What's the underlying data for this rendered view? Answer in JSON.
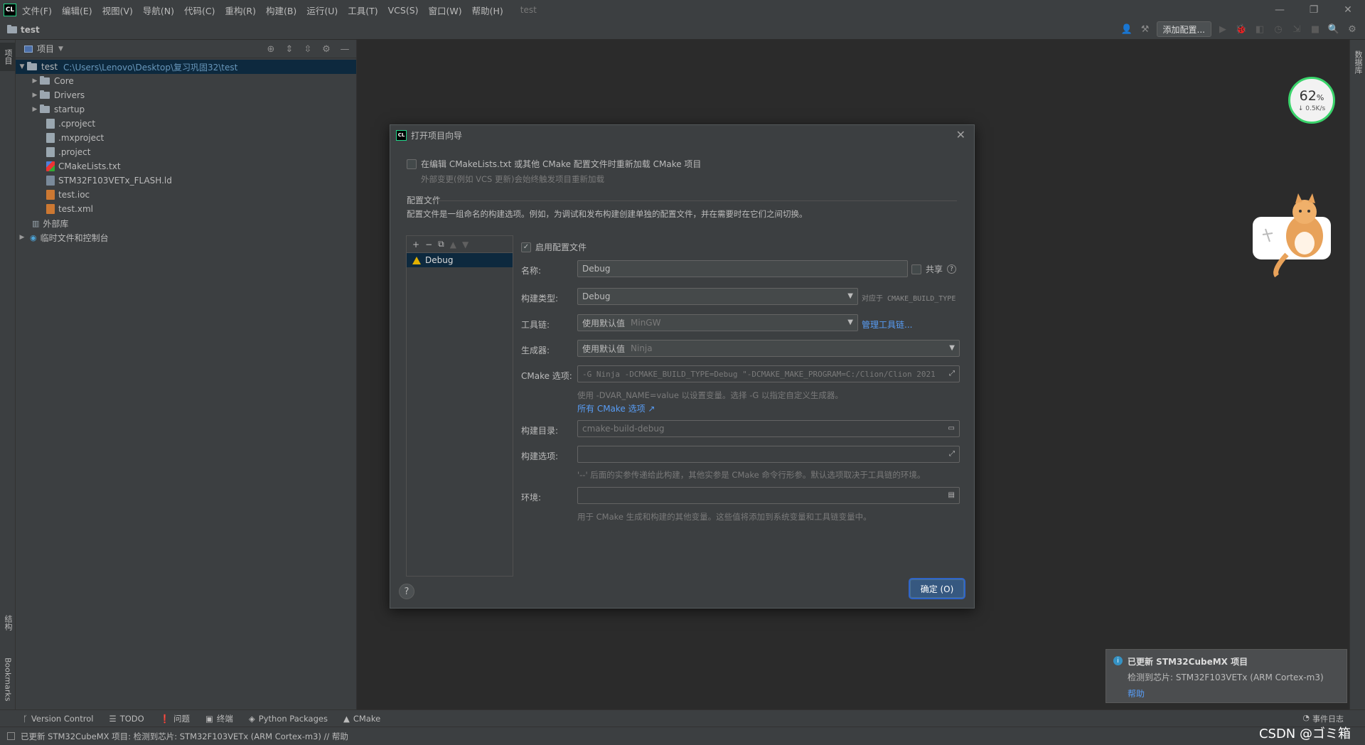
{
  "app": {
    "logo": "CL",
    "title": "test"
  },
  "menu": [
    "文件(F)",
    "编辑(E)",
    "视图(V)",
    "导航(N)",
    "代码(C)",
    "重构(R)",
    "构建(B)",
    "运行(U)",
    "工具(T)",
    "VCS(S)",
    "窗口(W)",
    "帮助(H)"
  ],
  "window_controls": {
    "minimize": "—",
    "restore": "❐",
    "close": "✕"
  },
  "navbar": {
    "project": "test",
    "add_config": "添加配置..."
  },
  "left_tabs": {
    "project": "项目",
    "structure": "结构",
    "bookmarks": "Bookmarks"
  },
  "right_tabs": {
    "database": "数据库"
  },
  "project_panel": {
    "title": "项目",
    "root": {
      "name": "test",
      "path": "C:\\Users\\Lenovo\\Desktop\\复习巩固32\\test"
    },
    "items": [
      {
        "name": "Core",
        "type": "folder"
      },
      {
        "name": "Drivers",
        "type": "folder"
      },
      {
        "name": "startup",
        "type": "folder"
      },
      {
        "name": ".cproject",
        "type": "file"
      },
      {
        "name": ".mxproject",
        "type": "file"
      },
      {
        "name": ".project",
        "type": "file"
      },
      {
        "name": "CMakeLists.txt",
        "type": "cmake"
      },
      {
        "name": "STM32F103VETx_FLASH.ld",
        "type": "ld"
      },
      {
        "name": "test.ioc",
        "type": "xml"
      },
      {
        "name": "test.xml",
        "type": "xml"
      }
    ],
    "external": "外部库",
    "scratches": "临时文件和控制台"
  },
  "dialog": {
    "title": "打开项目向导",
    "reload_label": "在编辑 CMakeLists.txt 或其他 CMake 配置文件时重新加载 CMake 项目",
    "reload_hint": "外部变更(例如 VCS 更新)会始终触发项目重新加载",
    "profiles_header": "配置文件",
    "profiles_desc": "配置文件是一组命名的构建选项。例如，为调试和发布构建创建单独的配置文件，并在需要时在它们之间切换。",
    "list_tools": [
      "+",
      "−",
      "⧉",
      "▲",
      "▼"
    ],
    "profile_item": "Debug",
    "enable_label": "启用配置文件",
    "name_label": "名称:",
    "name_value": "Debug",
    "share_label": "共享",
    "build_type_label": "构建类型:",
    "build_type_value": "Debug",
    "build_type_hint": "对应于 CMAKE_BUILD_TYPE",
    "toolchain_label": "工具链:",
    "toolchain_value": "使用默认值",
    "toolchain_sub": "MinGW",
    "toolchain_link": "管理工具链...",
    "generator_label": "生成器:",
    "generator_value": "使用默认值",
    "generator_sub": "Ninja",
    "cmake_options_label": "CMake 选项:",
    "cmake_options_value": "-G Ninja -DCMAKE_BUILD_TYPE=Debug \"-DCMAKE_MAKE_PROGRAM=C:/Clion/Clion 2021",
    "cmake_hint": "使用 -DVAR_NAME=value 以设置变量。选择 -G 以指定自定义生成器。",
    "cmake_link": "所有 CMake 选项 ↗",
    "build_dir_label": "构建目录:",
    "build_dir_value": "cmake-build-debug",
    "build_opts_label": "构建选项:",
    "build_opts_hint": "'--' 后面的实参传递给此构建，其他实参是 CMake 命令行形参。默认选项取决于工具链的环境。",
    "env_label": "环境:",
    "env_hint": "用于 CMake 生成和构建的其他变量。这些值将添加到系统变量和工具链变量中。",
    "ok": "确定 (O)",
    "help": "?"
  },
  "notification": {
    "title": "已更新 STM32CubeMX 项目",
    "body": "检测到芯片: STM32F103VETx (ARM Cortex-m3)",
    "link": "帮助"
  },
  "bottom_tabs": [
    "Version Control",
    "TODO",
    "问题",
    "终端",
    "Python Packages",
    "CMake"
  ],
  "event_log": "事件日志",
  "status": "已更新 STM32CubeMX 项目: 检测到芯片: STM32F103VETx (ARM Cortex-m3) // 帮助",
  "gauge": {
    "percent": "62",
    "unit": "%",
    "rate": "↓ 0.5K/s"
  },
  "watermark": "CSDN @ゴミ箱",
  "colors": {
    "accent": "#365880",
    "link": "#589df6",
    "selection": "#0d293e",
    "gauge": "#3ad46b"
  }
}
